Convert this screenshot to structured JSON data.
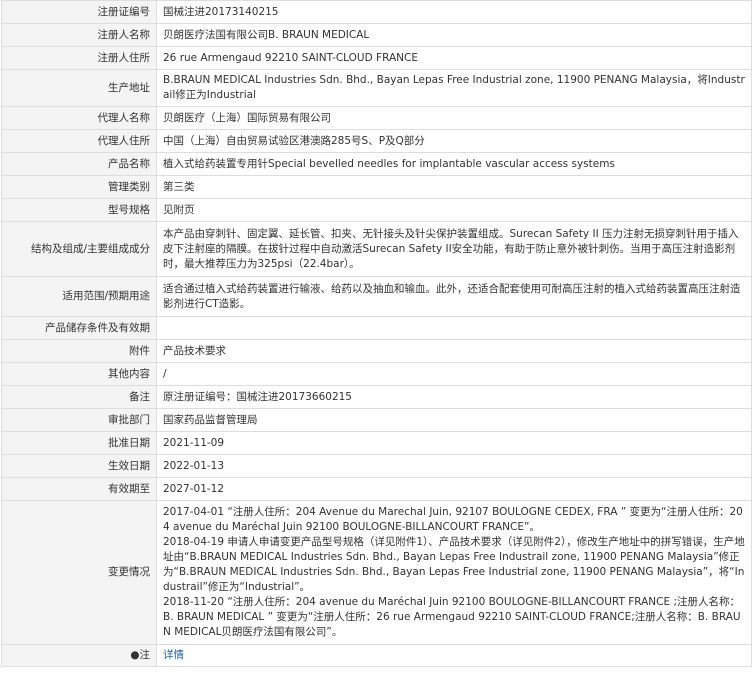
{
  "rows": [
    {
      "label": "注册证编号",
      "value": "国械注进20173140215"
    },
    {
      "label": "注册人名称",
      "value": "贝朗医疗法国有限公司B. BRAUN MEDICAL"
    },
    {
      "label": "注册人住所",
      "value": "26 rue Armengaud 92210 SAINT-CLOUD FRANCE"
    },
    {
      "label": "生产地址",
      "value": "B.BRAUN MEDICAL Industries Sdn. Bhd., Bayan Lepas Free Industrial zone, 11900 PENANG Malaysia，将Industrail修正为Industrial"
    },
    {
      "label": "代理人名称",
      "value": "贝朗医疗（上海）国际贸易有限公司"
    },
    {
      "label": "代理人住所",
      "value": "中国（上海）自由贸易试验区港澳路285号S、P及Q部分"
    },
    {
      "label": "产品名称",
      "value": "植入式给药装置专用针Special bevelled needles for implantable vascular access systems"
    },
    {
      "label": "管理类别",
      "value": "第三类"
    },
    {
      "label": "型号规格",
      "value": "见附页"
    },
    {
      "label": "结构及组成/主要组成成分",
      "value": "本产品由穿刺针、固定翼、延长管、扣夹、无针接头及针尖保护装置组成。Surecan Safety II 压力注射无损穿刺针用于插入皮下注射座的隔膜。在拔针过程中自动激活Surecan Safety II安全功能，有助于防止意外被针刺伤。当用于高压注射造影剂时，最大推荐压力为325psi（22.4bar）。"
    },
    {
      "label": "适用范围/预期用途",
      "value": "适合通过植入式给药装置进行输液、给药以及抽血和输血。此外，还适合配套使用可耐高压注射的植入式给药装置高压注射造影剂进行CT造影。"
    },
    {
      "label": "产品储存条件及有效期",
      "value": ""
    },
    {
      "label": "附件",
      "value": "产品技术要求"
    },
    {
      "label": "其他内容",
      "value": "/"
    },
    {
      "label": "备注",
      "value": "原注册证编号：国械注进20173660215"
    },
    {
      "label": "审批部门",
      "value": "国家药品监督管理局"
    },
    {
      "label": "批准日期",
      "value": "2021-11-09"
    },
    {
      "label": "生效日期",
      "value": "2022-01-13"
    },
    {
      "label": "有效期至",
      "value": "2027-01-12"
    }
  ],
  "history": {
    "label": "变更情况",
    "entries": [
      "2017-04-01 “注册人住所：204 Avenue du Marechal Juin, 92107 BOULOGNE CEDEX, FRA ” 变更为“注册人住所：204 avenue du Maréchal Juin 92100 BOULOGNE-BILLANCOURT FRANCE”。",
      "2018-04-19 申请人申请变更产品型号规格（详见附件1）、产品技术要求（详见附件2），修改生产地址中的拼写错误，生产地址由“B.BRAUN MEDICAL Industries Sdn. Bhd., Bayan Lepas Free Industrail zone, 11900 PENANG Malaysia”修正为“B.BRAUN MEDICAL Industries Sdn. Bhd., Bayan Lepas Free Industrial zone, 11900 PENANG Malaysia”，将“Industrail”修正为“Industrial”。",
      "2018-11-20 “注册人住所：204 avenue du Maréchal Juin 92100 BOULOGNE-BILLANCOURT FRANCE ;注册人名称：B. BRAUN MEDICAL ” 变更为“注册人住所：26 rue Armengaud 92210 SAINT-CLOUD FRANCE;注册人名称：B. BRAUN MEDICAL贝朗医疗法国有限公司”。"
    ]
  },
  "note": {
    "label": "●注",
    "link_text": "详情"
  }
}
